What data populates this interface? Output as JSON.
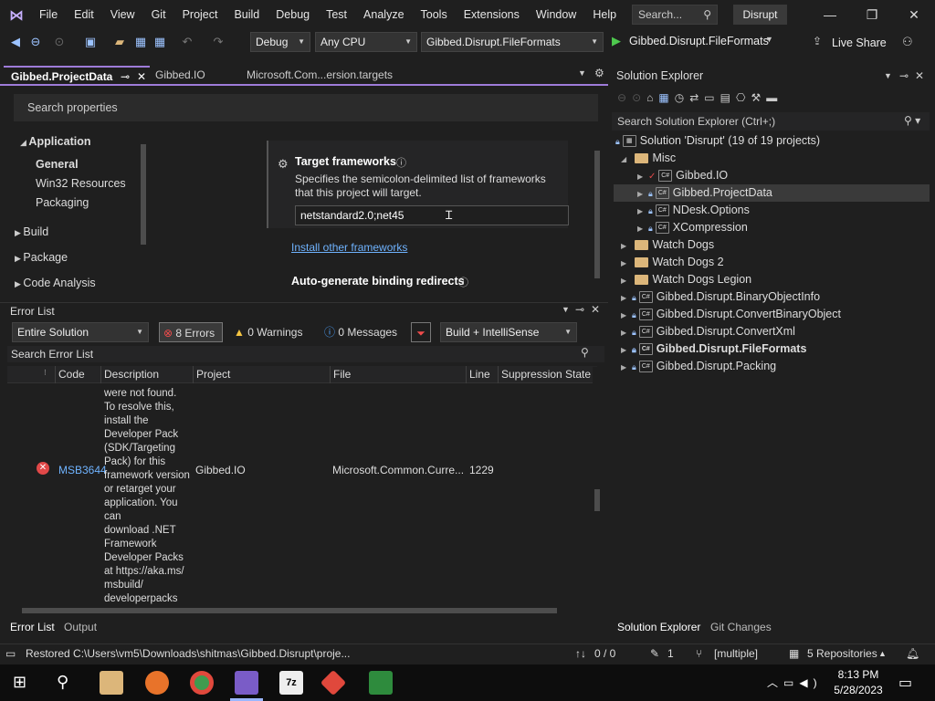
{
  "menu": [
    "File",
    "Edit",
    "View",
    "Git",
    "Project",
    "Build",
    "Debug",
    "Test",
    "Analyze",
    "Tools",
    "Extensions",
    "Window",
    "Help"
  ],
  "search_placeholder": "Search...",
  "solution_badge": "Disrupt",
  "toolbar": {
    "config": "Debug",
    "platform": "Any CPU",
    "startup_project": "Gibbed.Disrupt.FileFormats",
    "run_label": "Gibbed.Disrupt.FileFormats",
    "live_share": "Live Share"
  },
  "doc_tabs": [
    "Gibbed.ProjectData",
    "Gibbed.IO",
    "Microsoft.Com...ersion.targets"
  ],
  "props": {
    "search": "Search properties",
    "nav": {
      "application": "Application",
      "general": "General",
      "win32": "Win32 Resources",
      "packaging": "Packaging",
      "build": "Build",
      "package": "Package",
      "code_analysis": "Code Analysis"
    },
    "target_title": "Target frameworks",
    "target_desc1": "Specifies the semicolon-delimited list of frameworks",
    "target_desc2": "that this project will target.",
    "target_value": "netstandard2.0;net45",
    "install_link": "Install other frameworks",
    "autogen": "Auto-generate binding redirects"
  },
  "errors": {
    "title": "Error List",
    "scope": "Entire Solution",
    "errors_btn": "8 Errors",
    "warnings_btn": "0 Warnings",
    "messages_btn": "0 Messages",
    "source": "Build + IntelliSense",
    "search": "Search Error List",
    "columns": {
      "code": "Code",
      "description": "Description",
      "project": "Project",
      "file": "File",
      "line": "Line",
      "suppression": "Suppression State"
    },
    "row": {
      "code": "MSB3644",
      "project": "Gibbed.IO",
      "file": "Microsoft.Common.Curre...",
      "line": "1229"
    },
    "description_lines": [
      "were not found.",
      "To resolve this,",
      "install the",
      "Developer Pack",
      "(SDK/Targeting",
      "Pack) for this",
      "framework version",
      "or retarget your",
      "application. You",
      "can",
      "download .NET",
      "Framework",
      "Developer Packs",
      "at https://aka.ms/",
      "msbuild/",
      "developerpacks"
    ]
  },
  "bottom_tabs": {
    "error_list": "Error List",
    "output": "Output"
  },
  "solution_explorer": {
    "title": "Solution Explorer",
    "search": "Search Solution Explorer (Ctrl+;)",
    "solution": "Solution 'Disrupt' (19 of 19 projects)",
    "misc": "Misc",
    "projects_misc": [
      "Gibbed.IO",
      "Gibbed.ProjectData",
      "NDesk.Options",
      "XCompression"
    ],
    "folders": [
      "Watch Dogs",
      "Watch Dogs 2",
      "Watch Dogs Legion"
    ],
    "projects": [
      "Gibbed.Disrupt.BinaryObjectInfo",
      "Gibbed.Disrupt.ConvertBinaryObject",
      "Gibbed.Disrupt.ConvertXml",
      "Gibbed.Disrupt.FileFormats",
      "Gibbed.Disrupt.Packing"
    ],
    "tab_solution": "Solution Explorer",
    "tab_git": "Git Changes"
  },
  "status": {
    "message": "Restored C:\\Users\\vm5\\Downloads\\shitmas\\Gibbed.Disrupt\\proje...",
    "updown": "0 / 0",
    "pencil": "1",
    "branch": "[multiple]",
    "repos": "5 Repositories"
  },
  "clock": {
    "time": "8:13 PM",
    "date": "5/28/2023"
  }
}
